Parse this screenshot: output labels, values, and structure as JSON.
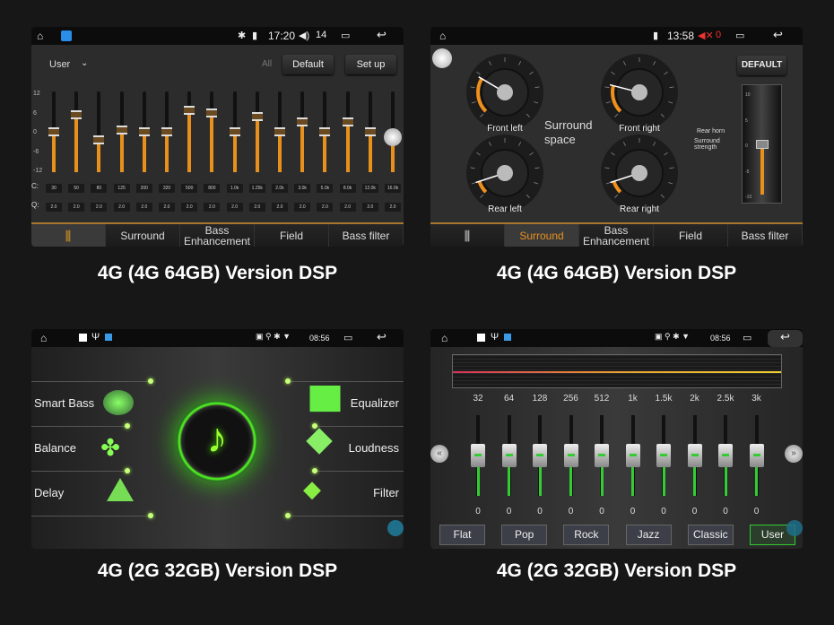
{
  "captions": [
    "4G (4G 64GB) Version DSP",
    "4G (4G 64GB) Version DSP",
    "4G (2G 32GB) Version DSP",
    "4G (2G 32GB) Version DSP"
  ],
  "panel1": {
    "status": {
      "time": "17:20",
      "volume": "14"
    },
    "preset": "User",
    "all_label": "All",
    "default_label": "Default",
    "setup_label": "Set up",
    "y_ticks": [
      "12",
      "6",
      "0",
      "-6",
      "-12"
    ],
    "fc_label": "C:",
    "q_label": "Q:",
    "bands": [
      {
        "fc": "30",
        "q": "2.0",
        "gain": 0
      },
      {
        "fc": "50",
        "q": "2.0",
        "gain": 5
      },
      {
        "fc": "80",
        "q": "2.0",
        "gain": -2.5
      },
      {
        "fc": "125",
        "q": "2.0",
        "gain": 0.5
      },
      {
        "fc": "200",
        "q": "2.0",
        "gain": 0
      },
      {
        "fc": "320",
        "q": "2.0",
        "gain": 0
      },
      {
        "fc": "500",
        "q": "2.0",
        "gain": 6.5
      },
      {
        "fc": "800",
        "q": "2.0",
        "gain": 5.5
      },
      {
        "fc": "1.0k",
        "q": "2.0",
        "gain": 0
      },
      {
        "fc": "1.25k",
        "q": "2.0",
        "gain": 4.5
      },
      {
        "fc": "2.0k",
        "q": "2.0",
        "gain": 0
      },
      {
        "fc": "3.0k",
        "q": "2.0",
        "gain": 3
      },
      {
        "fc": "5.0k",
        "q": "2.0",
        "gain": 0
      },
      {
        "fc": "8.0k",
        "q": "2.0",
        "gain": 3
      },
      {
        "fc": "12.0k",
        "q": "2.0",
        "gain": 0
      },
      {
        "fc": "16.0k",
        "q": "2.0",
        "gain": -1.5
      }
    ],
    "tabs": [
      "Surround",
      "Bass Enhancement",
      "Field",
      "Bass filter"
    ]
  },
  "panel2": {
    "status": {
      "time": "13:58",
      "volume": "0"
    },
    "default_label": "DEFAULT",
    "surround_label": "Surround space",
    "gauges": [
      {
        "label": "Front left",
        "value": 0.28
      },
      {
        "label": "Front right",
        "value": 0.22
      },
      {
        "label": "Rear left",
        "value": 0.1
      },
      {
        "label": "Rear right",
        "value": 0.1
      }
    ],
    "rear_horn_label": "Rear horn",
    "strength_label": "Surround strength",
    "strength_value": 0,
    "strength_range": [
      -10,
      10
    ],
    "slider_ticks": [
      "10",
      "5",
      "0",
      "-5",
      "-10"
    ],
    "tabs": [
      "Surround",
      "Bass Enhancement",
      "Field",
      "Bass filter"
    ],
    "active_tab": "Surround"
  },
  "panel3": {
    "status": {
      "time": "08:56"
    },
    "left_items": [
      "Smart Bass",
      "Balance",
      "Delay"
    ],
    "right_items": [
      "Equalizer",
      "Loudness",
      "Filter"
    ],
    "accent": "#7cff3a"
  },
  "panel4": {
    "status": {
      "time": "08:56"
    },
    "bands": [
      {
        "f": "32",
        "v": 0
      },
      {
        "f": "64",
        "v": 0
      },
      {
        "f": "128",
        "v": 0
      },
      {
        "f": "256",
        "v": 0
      },
      {
        "f": "512",
        "v": 0
      },
      {
        "f": "1k",
        "v": 0
      },
      {
        "f": "1.5k",
        "v": 0
      },
      {
        "f": "2k",
        "v": 0
      },
      {
        "f": "2.5k",
        "v": 0
      },
      {
        "f": "3k",
        "v": 0
      }
    ],
    "presets": [
      "Flat",
      "Pop",
      "Rock",
      "Jazz",
      "Classic",
      "User"
    ],
    "selected": "User"
  }
}
